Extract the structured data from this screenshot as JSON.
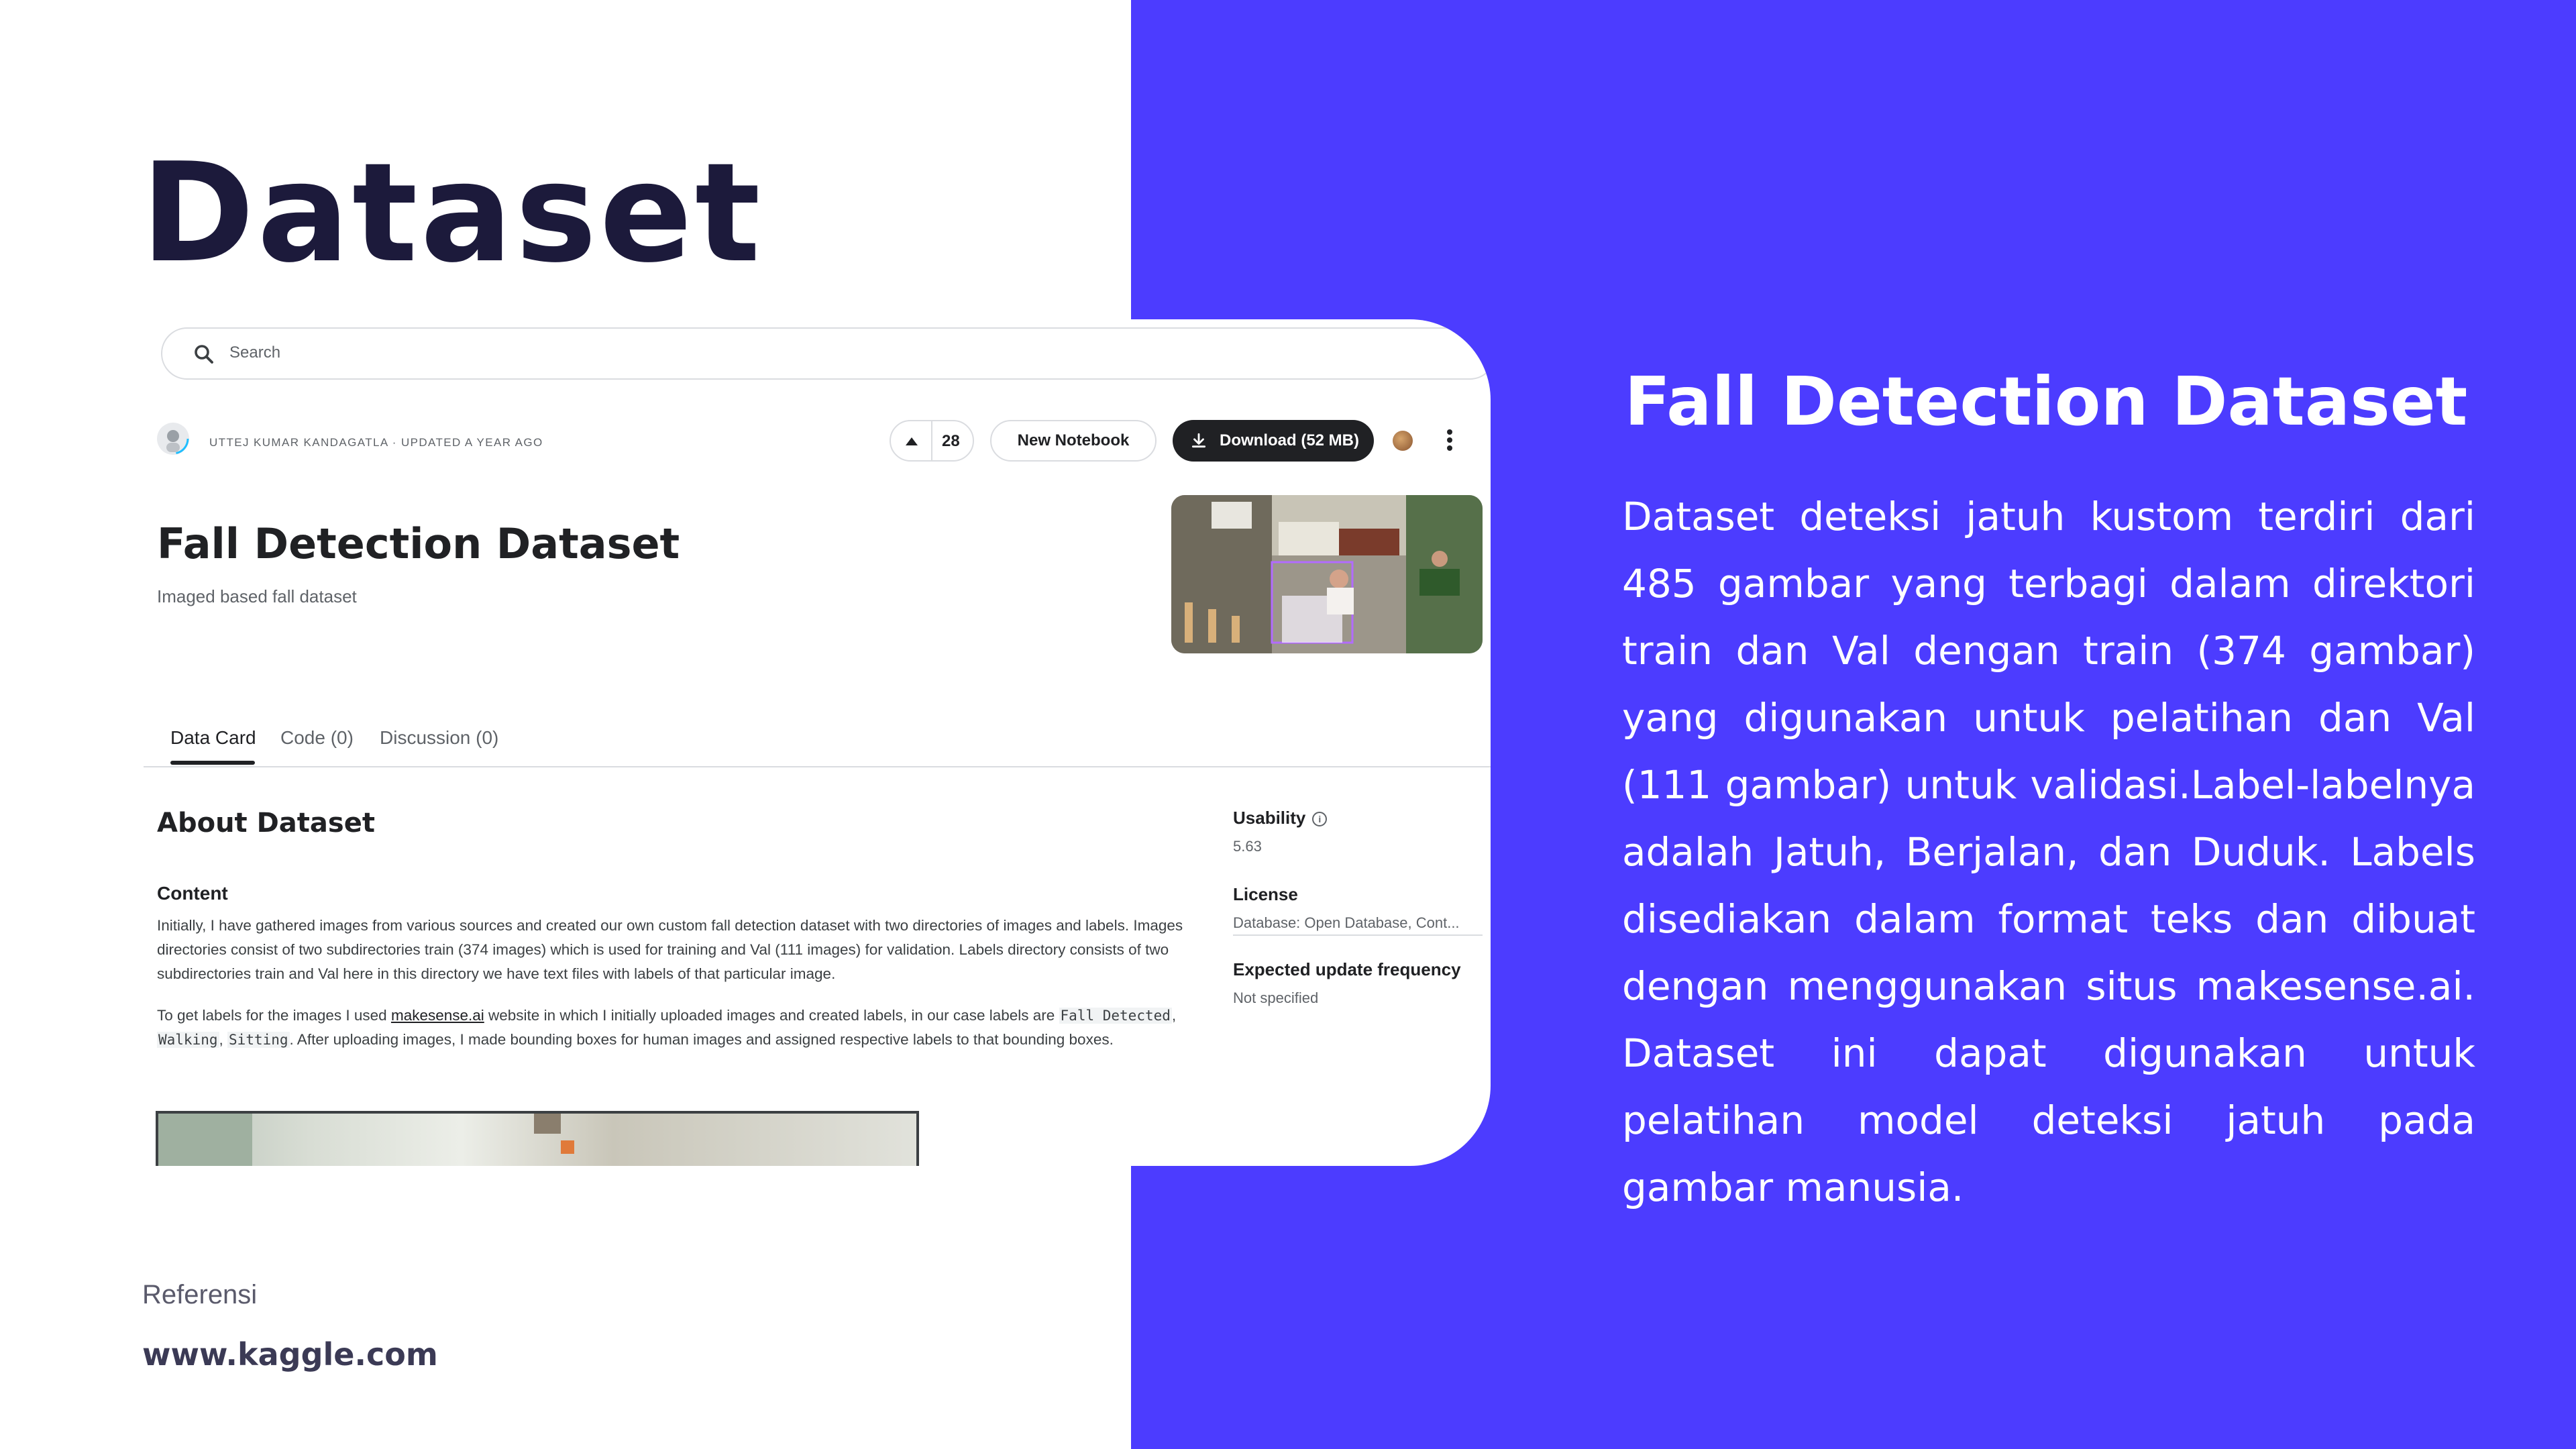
{
  "slide": {
    "title": "Dataset",
    "reference_label": "Referensi",
    "reference_url": "www.kaggle.com",
    "colors": {
      "accent": "#4c3cff",
      "title": "#1c1a3b"
    }
  },
  "right": {
    "title": "Fall Detection Dataset",
    "description": "Dataset deteksi jatuh kustom terdiri dari 485 gambar yang terbagi dalam direktori train dan Val dengan train (374 gambar) yang digunakan untuk pelatihan dan Val (111 gambar) untuk validasi.Label-labelnya adalah Jatuh, Berjalan, dan Duduk. Labels disediakan dalam format teks dan dibuat dengan menggunakan situs makesense.ai. Dataset ini dapat digunakan untuk pelatihan model deteksi jatuh pada gambar manusia."
  },
  "kaggle": {
    "search_placeholder": "Search",
    "author_line": "UTTEJ KUMAR KANDAGATLA · UPDATED A YEAR AGO",
    "vote_count": "28",
    "new_notebook_label": "New Notebook",
    "download_label": "Download (52 MB)",
    "dataset_title": "Fall Detection Dataset",
    "dataset_subtitle": "Imaged based fall dataset",
    "tabs": [
      {
        "label": "Data Card",
        "active": true
      },
      {
        "label": "Code (0)",
        "active": false
      },
      {
        "label": "Discussion (0)",
        "active": false
      }
    ],
    "about_heading": "About Dataset",
    "content_heading": "Content",
    "paragraph1": "Initially, I have gathered images from various sources and created our own custom fall detection dataset with two directories of images and labels. Images directories consist of two subdirectories train (374 images) which is used for training and Val (111 images) for validation. Labels directory consists of two subdirectories train and Val here in this directory we have text files with labels of that particular image.",
    "paragraph2": {
      "part1": "To get labels for the images I used ",
      "link": "makesense.ai",
      "part2": " website in which I initially uploaded images and created labels, in our case labels are ",
      "code1": "Fall Detected",
      "sep1": ", ",
      "code2": "Walking",
      "sep2": ", ",
      "code3": "Sitting",
      "part3": ". After uploading images, I made bounding boxes for human images and assigned respective labels to that bounding boxes."
    },
    "usability_label": "Usability",
    "usability_value": "5.63",
    "license_label": "License",
    "license_value": "Database: Open Database, Cont...",
    "update_freq_label": "Expected update frequency",
    "update_freq_value": "Not specified"
  }
}
